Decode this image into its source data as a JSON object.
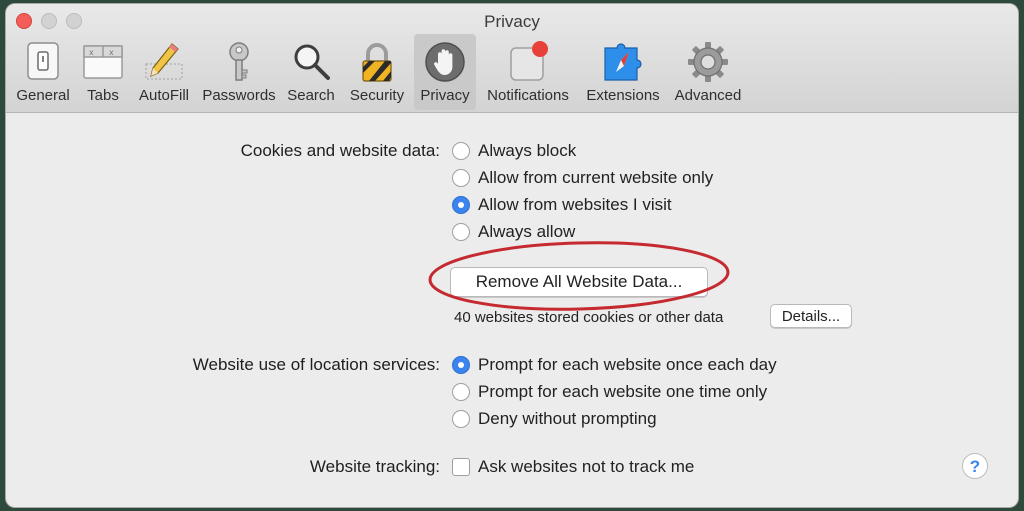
{
  "window": {
    "title": "Privacy",
    "controls": [
      "close-button",
      "minimize-button",
      "zoom-button"
    ]
  },
  "toolbar": {
    "items": [
      {
        "label": "General",
        "icon": "switch-icon"
      },
      {
        "label": "Tabs",
        "icon": "tabs-icon"
      },
      {
        "label": "AutoFill",
        "icon": "pencil-icon"
      },
      {
        "label": "Passwords",
        "icon": "key-icon"
      },
      {
        "label": "Search",
        "icon": "magnifier-icon"
      },
      {
        "label": "Security",
        "icon": "padlock-icon"
      },
      {
        "label": "Privacy",
        "icon": "hand-icon",
        "selected": true
      },
      {
        "label": "Notifications",
        "icon": "notification-badge-icon"
      },
      {
        "label": "Extensions",
        "icon": "puzzle-compass-icon"
      },
      {
        "label": "Advanced",
        "icon": "gear-icon"
      }
    ]
  },
  "cookies": {
    "label": "Cookies and website data:",
    "options": [
      {
        "label": "Always block",
        "checked": false
      },
      {
        "label": "Allow from current website only",
        "checked": false
      },
      {
        "label": "Allow from websites I visit",
        "checked": true
      },
      {
        "label": "Always allow",
        "checked": false
      }
    ],
    "remove_button": "Remove All Website Data...",
    "stored_info": "40 websites stored cookies or other data",
    "details_button": "Details..."
  },
  "location": {
    "label": "Website use of location services:",
    "options": [
      {
        "label": "Prompt for each website once each day",
        "checked": true
      },
      {
        "label": "Prompt for each website one time only",
        "checked": false
      },
      {
        "label": "Deny without prompting",
        "checked": false
      }
    ]
  },
  "tracking": {
    "label": "Website tracking:",
    "checkbox_label": "Ask websites not to track me",
    "checked": false
  },
  "help": {
    "glyph": "?"
  },
  "colors": {
    "accent": "#3b84ee",
    "annotation_ring": "#c42a30",
    "close_light": "#f35e58"
  }
}
